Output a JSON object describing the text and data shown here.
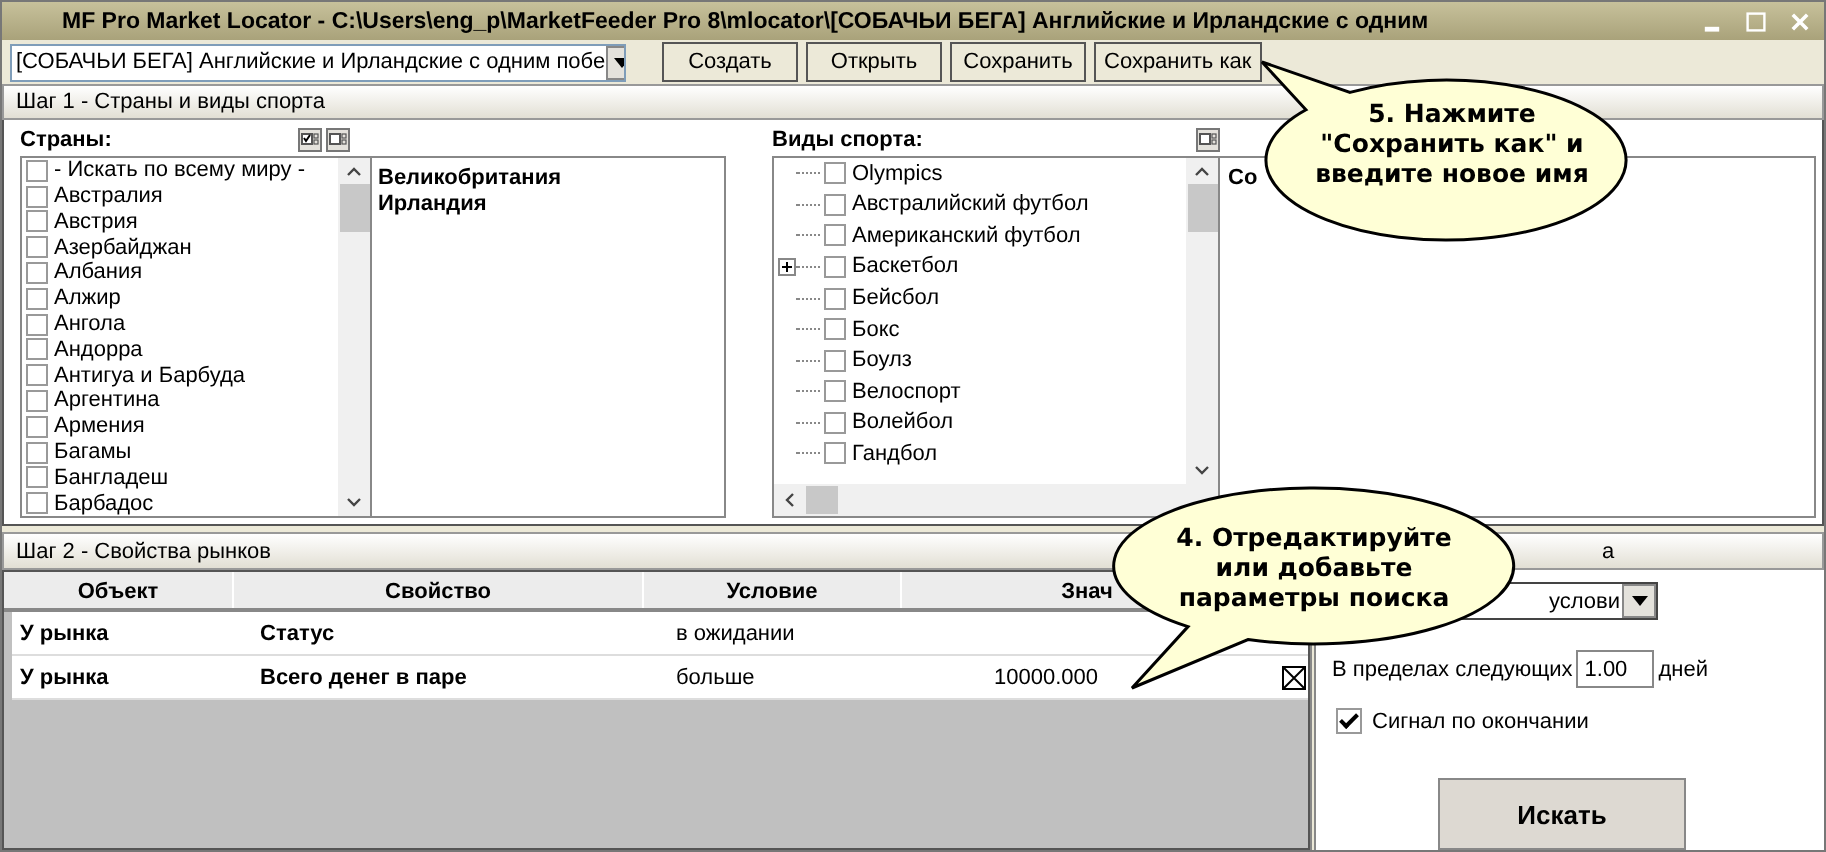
{
  "window": {
    "title": "MF Pro Market Locator - C:\\Users\\eng_p\\MarketFeeder Pro 8\\mlocator\\[СОБАЧЬИ БЕГА] Английские и Ирландские с одним"
  },
  "toolbar": {
    "preset": "[СОБАЧЬИ БЕГА] Английские и Ирландские с одним побе",
    "buttons": [
      "Создать",
      "Открыть",
      "Сохранить",
      "Сохранить как"
    ]
  },
  "step1": {
    "title": "Шаг 1 - Страны и виды спорта",
    "countries": {
      "label": "Страны:",
      "items": [
        {
          "label": " - Искать по всему миру -",
          "checked": false
        },
        {
          "label": "Австралия",
          "checked": false
        },
        {
          "label": "Австрия",
          "checked": false
        },
        {
          "label": "Азербайджан",
          "checked": false
        },
        {
          "label": "Албания",
          "checked": false
        },
        {
          "label": "Алжир",
          "checked": false
        },
        {
          "label": "Ангола",
          "checked": false
        },
        {
          "label": "Андорра",
          "checked": false
        },
        {
          "label": "Антигуа и Барбуда",
          "checked": false
        },
        {
          "label": "Аргентина",
          "checked": false
        },
        {
          "label": "Армения",
          "checked": false
        },
        {
          "label": "Багамы",
          "checked": false
        },
        {
          "label": "Бангладеш",
          "checked": false
        },
        {
          "label": "Барбадос",
          "checked": false
        }
      ],
      "selected": [
        "Великобритания",
        "Ирландия"
      ]
    },
    "sports": {
      "label": "Виды спорта:",
      "items": [
        {
          "label": "Olympics",
          "checked": false,
          "expandable": false
        },
        {
          "label": "Австралийский футбол",
          "checked": false,
          "expandable": false
        },
        {
          "label": "Американский футбол",
          "checked": false,
          "expandable": false
        },
        {
          "label": "Баскетбол",
          "checked": false,
          "expandable": true
        },
        {
          "label": "Бейсбол",
          "checked": false,
          "expandable": false
        },
        {
          "label": "Бокс",
          "checked": false,
          "expandable": false
        },
        {
          "label": "Боулз",
          "checked": false,
          "expandable": false
        },
        {
          "label": "Велоспорт",
          "checked": false,
          "expandable": false
        },
        {
          "label": "Волейбол",
          "checked": false,
          "expandable": false
        },
        {
          "label": "Гандбол",
          "checked": false,
          "expandable": false
        }
      ],
      "selected_header": "Со"
    }
  },
  "step2": {
    "title": "Шаг 2 - Свойства рынков",
    "columns": [
      "Объект",
      "Свойство",
      "Условие",
      "Знач"
    ],
    "rows": [
      {
        "cells": [
          "У рынка",
          "Статус",
          "в ожидании",
          ""
        ],
        "removable": false
      },
      {
        "cells": [
          "У рынка",
          "Всего денег в паре",
          "больше",
          "10000.000"
        ],
        "removable": true
      }
    ]
  },
  "search_panel": {
    "title": "а",
    "mode": "услови",
    "within_label": "В пределах следующих",
    "within_value": "1.00",
    "within_unit": "дней",
    "signal": {
      "label": "Сигнал по окончании",
      "checked": true
    },
    "button": "Искать"
  },
  "callouts": [
    {
      "text": "5. Нажмите \"Сохранить как\" и введите новое имя"
    },
    {
      "text": "4. Отредактируйте или добавьте параметры поиска"
    }
  ]
}
